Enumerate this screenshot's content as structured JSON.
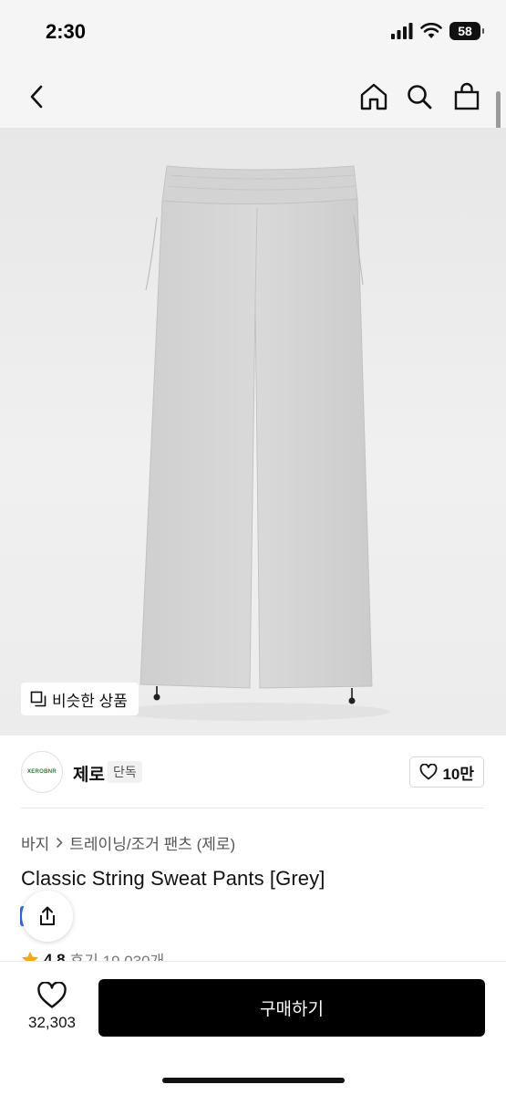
{
  "status_bar": {
    "time": "2:30",
    "battery": "58"
  },
  "nav": {
    "icons": [
      "back-arrow-icon",
      "home-icon",
      "search-icon",
      "shopping-bag-icon"
    ]
  },
  "product": {
    "similar_label": "비슷한 상품",
    "brand_logo_text": "XEROBNR",
    "brand_name": "제로",
    "exclusive_badge": "단독",
    "brand_likes": "10만",
    "breadcrumb": [
      "바지",
      "트레이닝/조거 팬츠 (제로)"
    ],
    "title": "Classic String Sweat Pants [Grey]",
    "rating": "4.8",
    "reviews": "후기 19,030개"
  },
  "bottom": {
    "wish_count": "32,303",
    "buy_label": "구매하기"
  },
  "colors": {
    "accent_star": "#f5a623",
    "buy_button": "#000000",
    "badge_blue": "#2f6fd6"
  }
}
